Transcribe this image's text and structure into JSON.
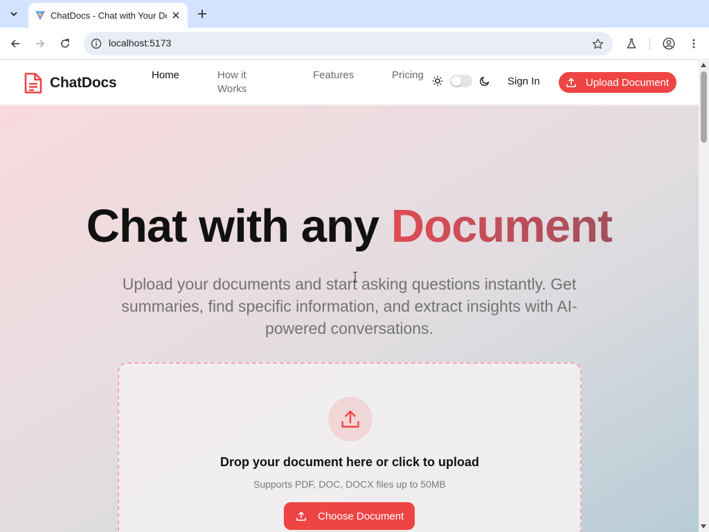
{
  "browser": {
    "tab_title": "ChatDocs - Chat with Your Documents",
    "url": "localhost:5173"
  },
  "header": {
    "logo_text": "ChatDocs",
    "nav": [
      {
        "label": "Home",
        "active": true
      },
      {
        "label": "How it Works",
        "active": false
      },
      {
        "label": "Features",
        "active": false
      },
      {
        "label": "Pricing",
        "active": false
      }
    ],
    "theme_toggle": {
      "dark_mode": false
    },
    "signin_label": "Sign In",
    "upload_label": "Upload Document"
  },
  "hero": {
    "title_part1": "Chat with any ",
    "title_accent": "Document",
    "subtitle": "Upload your documents and start asking questions instantly. Get summaries, find specific information, and extract insights with AI-powered conversations."
  },
  "dropzone": {
    "title": "Drop your document here or click to upload",
    "note": "Supports PDF, DOC, DOCX files up to 50MB",
    "button_label": "Choose Document"
  },
  "colors": {
    "accent": "#ef4444",
    "accent_dark": "#a2505d",
    "chrome_tabstrip": "#d3e3fd",
    "omnibox": "#e9eef6"
  },
  "icons": [
    "chevron-down-icon",
    "vite-favicon",
    "close-icon",
    "plus-icon",
    "back-arrow-icon",
    "forward-arrow-icon",
    "reload-icon",
    "info-icon",
    "star-icon",
    "labs-flask-icon",
    "profile-icon",
    "more-vert-icon",
    "document-logo-icon",
    "sun-icon",
    "moon-icon",
    "upload-icon"
  ]
}
